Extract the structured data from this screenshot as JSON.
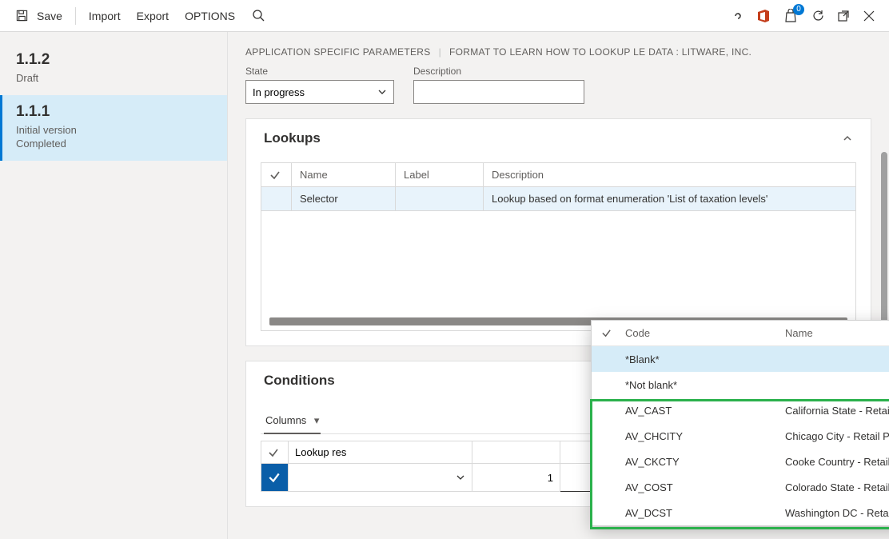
{
  "toolbar": {
    "save": "Save",
    "import": "Import",
    "export": "Export",
    "options": "OPTIONS",
    "badge_count": "0"
  },
  "sidebar": [
    {
      "version": "1.1.2",
      "line1": "Draft",
      "line2": ""
    },
    {
      "version": "1.1.1",
      "line1": "Initial version",
      "line2": "Completed"
    }
  ],
  "breadcrumb": {
    "a": "APPLICATION SPECIFIC PARAMETERS",
    "b": "FORMAT TO LEARN HOW TO LOOKUP LE DATA : LITWARE, INC."
  },
  "fields": {
    "state_label": "State",
    "state_value": "In progress",
    "desc_label": "Description",
    "desc_value": ""
  },
  "lookups": {
    "title": "Lookups",
    "columns": {
      "name": "Name",
      "label": "Label",
      "desc": "Description"
    },
    "row": {
      "name": "Selector",
      "label": "",
      "desc": "Lookup based on format enumeration 'List of taxation levels'"
    }
  },
  "conditions": {
    "title": "Conditions",
    "tab": "Columns",
    "columns": {
      "lookup": "Lookup res"
    },
    "row_line": "1"
  },
  "popup": {
    "col_code": "Code",
    "col_name": "Name",
    "rows": [
      {
        "code": "*Blank*",
        "name": ""
      },
      {
        "code": "*Not blank*",
        "name": ""
      },
      {
        "code": "AV_CAST",
        "name": "California State - Retail Prod"
      },
      {
        "code": "AV_CHCITY",
        "name": "Chicago City - Retail Prod"
      },
      {
        "code": "AV_CKCTY",
        "name": "Cooke Country - Retail Prod"
      },
      {
        "code": "AV_COST",
        "name": "Colorado State - Retail Prod"
      },
      {
        "code": "AV_DCST",
        "name": "Washington DC - Retail Prod"
      }
    ]
  }
}
